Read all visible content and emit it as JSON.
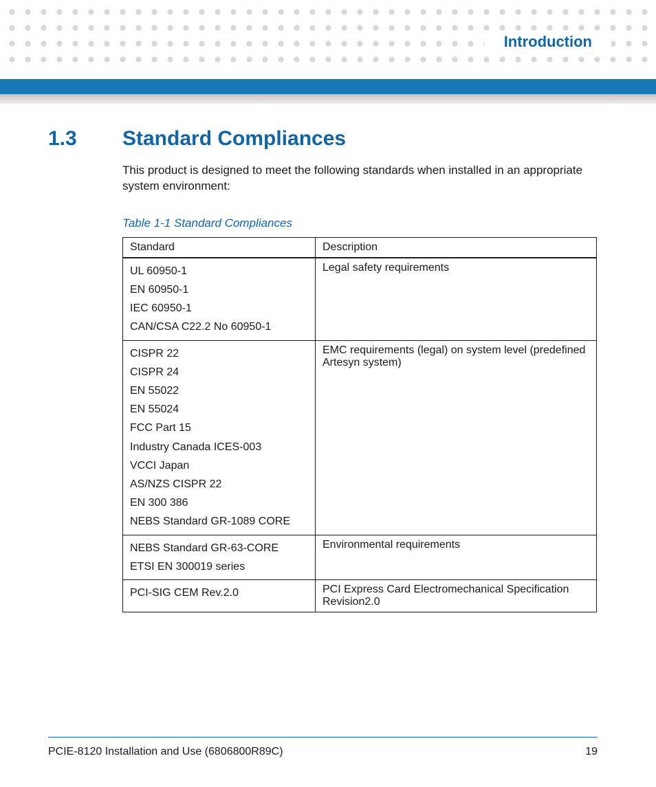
{
  "header": {
    "chapter_title": "Introduction"
  },
  "section": {
    "number": "1.3",
    "title": "Standard Compliances",
    "intro": "This product is designed to meet the following standards when installed in an appropriate system environment:"
  },
  "table": {
    "caption": "Table 1-1 Standard Compliances",
    "headers": [
      "Standard",
      "Description"
    ],
    "rows": [
      {
        "standards": [
          "UL 60950-1",
          "EN 60950-1",
          "IEC 60950-1",
          "CAN/CSA C22.2 No 60950-1"
        ],
        "description": "Legal safety requirements"
      },
      {
        "standards": [
          "CISPR 22",
          "CISPR 24",
          "EN 55022",
          "EN 55024",
          "FCC Part 15",
          "Industry Canada ICES-003",
          "VCCI Japan",
          "AS/NZS CISPR 22",
          "EN 300 386",
          "NEBS Standard GR-1089 CORE"
        ],
        "description": "EMC requirements (legal) on system level (predefined Artesyn system)"
      },
      {
        "standards": [
          "NEBS Standard GR-63-CORE",
          "ETSI EN 300019 series"
        ],
        "description": "Environmental requirements"
      },
      {
        "standards": [
          "PCI-SIG CEM Rev.2.0"
        ],
        "description": "PCI Express Card Electromechanical Specification Revision2.0"
      }
    ]
  },
  "footer": {
    "doc_title": "PCIE-8120 Installation and Use (6806800R89C)",
    "page_number": "19"
  }
}
